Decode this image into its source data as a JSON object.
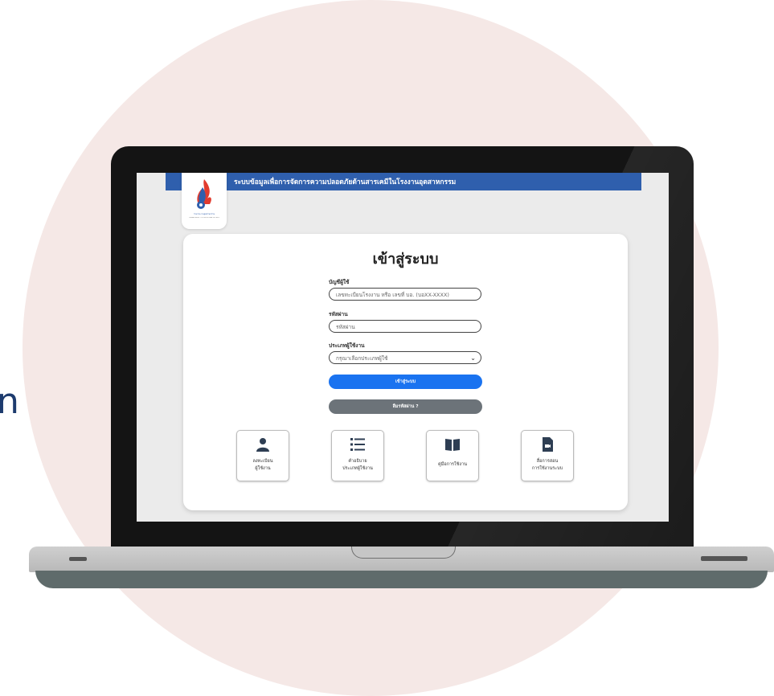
{
  "edge_text": "n",
  "app": {
    "title": "ระบบข้อมูลเพื่อการจัดการความปลอดภัยด้านสารเคมีในโรงงานอุตสาหกรรม",
    "logo_caption": "กรมโรงงานอุตสาหกรรม",
    "logo_sub": "DEPARTMENT OF INDUSTRIAL WORKS"
  },
  "login": {
    "title": "เข้าสู่ระบบ",
    "username_label": "บัญชีผู้ใช้",
    "username_placeholder": "เลขทะเบียนโรงงาน หรือ เลขที่ บอ. (บอXX-XXXX)",
    "password_label": "รหัสผ่าน",
    "password_placeholder": "รหัสผ่าน",
    "user_type_label": "ประเภทผู้ใช้งาน",
    "user_type_selected": "กรุณาเลือกประเภทผู้ใช้",
    "login_button": "เข้าสู่ระบบ",
    "forgot_button": "ลืมรหัสผ่าน ?"
  },
  "tiles": [
    {
      "icon": "user-icon",
      "line1": "ลงทะเบียน",
      "line2": "ผู้ใช้งาน"
    },
    {
      "icon": "list-icon",
      "line1": "คำอธิบาย",
      "line2": "ประเภทผู้ใช้งาน"
    },
    {
      "icon": "book-icon",
      "line1": "คู่มือการใช้งาน",
      "line2": ""
    },
    {
      "icon": "video-file-icon",
      "line1": "สื่อการสอน",
      "line2": "การใช้งานระบบ"
    }
  ],
  "colors": {
    "header_blue": "#2f5fad",
    "login_button": "#1a73f0",
    "forgot_button": "#6c7379",
    "icon_dark": "#2e3e53",
    "background_circle": "#f5e8e6"
  }
}
